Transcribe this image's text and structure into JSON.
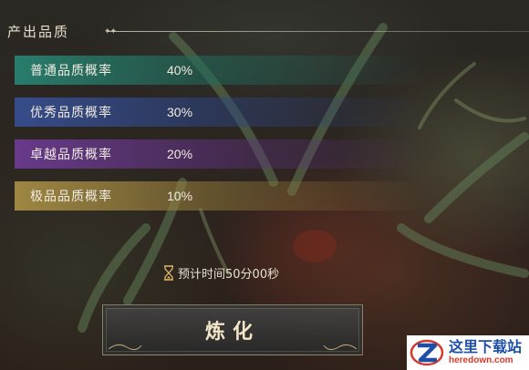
{
  "section": {
    "title": "产出品质"
  },
  "quality_rates": [
    {
      "label": "普通品质概率",
      "value": "40%",
      "color": "#2a8c78"
    },
    {
      "label": "优秀品质概率",
      "value": "30%",
      "color": "#3a5296"
    },
    {
      "label": "卓越品质概率",
      "value": "20%",
      "color": "#6e3c96"
    },
    {
      "label": "极品品质概率",
      "value": "10%",
      "color": "#aa9146"
    }
  ],
  "timer": {
    "text": "预计时间50分00秒",
    "icon": "hourglass-icon"
  },
  "action": {
    "label": "炼化"
  },
  "watermark": {
    "name": "这里下载站",
    "domain": "heredown.com"
  }
}
